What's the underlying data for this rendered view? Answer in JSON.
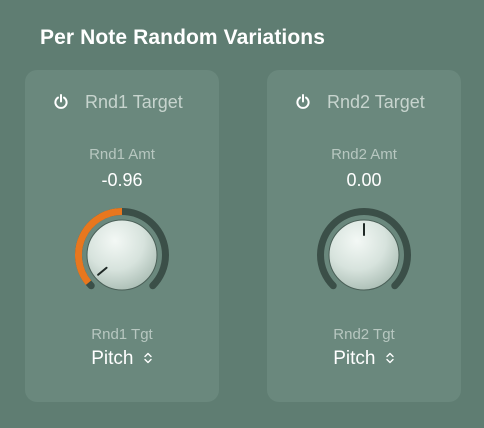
{
  "section": {
    "title": "Per Note Random Variations"
  },
  "colors": {
    "accent": "#e8771e",
    "background": "#5f7d72",
    "panel": "#6a887d"
  },
  "panels": [
    {
      "power_icon": "power-icon",
      "target_label": "Rnd1 Target",
      "amount_label": "Rnd1 Amt",
      "amount_value": "-0.96",
      "amount_number": -0.96,
      "range": [
        -1,
        1
      ],
      "target_param_label": "Rnd1 Tgt",
      "target_value": "Pitch",
      "select_icon": "chevron-up-down-icon"
    },
    {
      "power_icon": "power-icon",
      "target_label": "Rnd2 Target",
      "amount_label": "Rnd2 Amt",
      "amount_value": "0.00",
      "amount_number": 0.0,
      "range": [
        -1,
        1
      ],
      "target_param_label": "Rnd2 Tgt",
      "target_value": "Pitch",
      "select_icon": "chevron-up-down-icon"
    }
  ]
}
